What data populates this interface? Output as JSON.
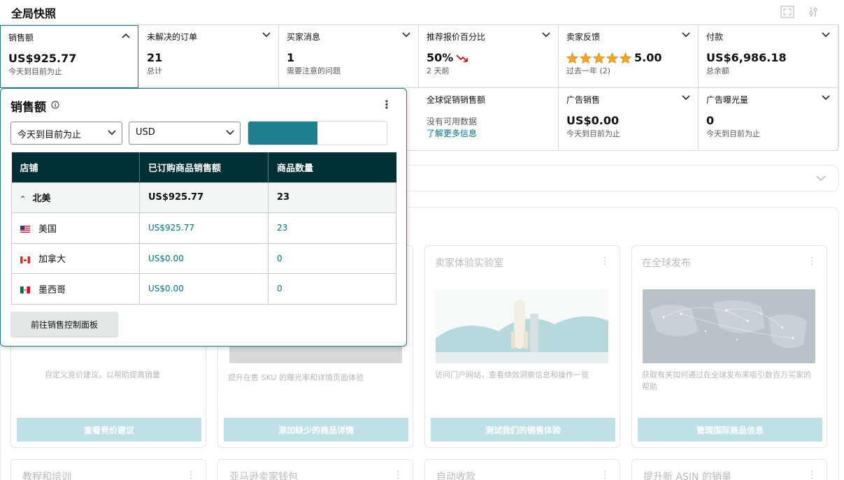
{
  "header": {
    "title": "全局快照",
    "fullscreen_icon": "expand-icon",
    "settings_icon": "sliders-icon"
  },
  "metrics": [
    {
      "label": "销售额",
      "value": "US$925.77",
      "sub": "今天到目前为止",
      "expanded": true
    },
    {
      "label": "未解决的订单",
      "value": "21",
      "sub": "总计"
    },
    {
      "label": "买家消息",
      "value": "1",
      "sub": "需要注意的问题"
    },
    {
      "label": "推荐报价百分比",
      "value": "50%",
      "sub": "2 天前",
      "trend": "down"
    },
    {
      "label": "卖家反馈",
      "value": "5.00",
      "sub": "过去一年 (2)",
      "stars": 5
    },
    {
      "label": "付款",
      "value": "US$6,986.18",
      "sub": "总余额"
    },
    {
      "label": "全球促销销售额",
      "sub": "没有可用数据",
      "link": "了解更多信息"
    },
    {
      "label": "广告销售",
      "value": "US$0.00",
      "sub": "今天到目前为止"
    },
    {
      "label": "广告曝光量",
      "value": "0",
      "sub": "今天到目前为止"
    }
  ],
  "popover": {
    "title": "销售额",
    "period_select": "今天到目前为止",
    "currency_select": "USD",
    "columns": [
      "店铺",
      "已订购商品销售额",
      "商品数量"
    ],
    "region": {
      "name": "北美",
      "sales": "US$925.77",
      "units": "23"
    },
    "rows": [
      {
        "flag": "us-flag-icon",
        "name": "美国",
        "sales": "US$925.77",
        "units": "23"
      },
      {
        "flag": "ca-flag-icon",
        "name": "加拿大",
        "sales": "US$0.00",
        "units": "0"
      },
      {
        "flag": "mx-flag-icon",
        "name": "墨西哥",
        "sales": "US$0.00",
        "units": "0"
      }
    ],
    "button": "前往销售控制面板"
  },
  "cards": [
    {
      "title": "",
      "desc": "自定义竞价建议，以帮助提高销量",
      "button": "查看竞价建议"
    },
    {
      "title": "",
      "desc": "提升在售 SKU 的曝光率和详情页面体验",
      "button": "添加缺少的商品详情"
    },
    {
      "title": "卖家体验实验室",
      "desc": "访问门户网站，查看绩效洞察信息和操作一览",
      "button": "测试我们的销售体验"
    },
    {
      "title": "在全球发布",
      "desc": "获取有关如何通过在全球发布来吸引数百万买家的帮助",
      "button": "管理国际商品信息"
    }
  ],
  "cards_row2": [
    "教程和培训",
    "亚马逊卖家钱包",
    "自动收款",
    "提升新 ASIN 的销量"
  ],
  "colors": {
    "accent": "#1f8091",
    "header_bg": "#002f36",
    "link": "#007185",
    "star": "#f5a623"
  }
}
